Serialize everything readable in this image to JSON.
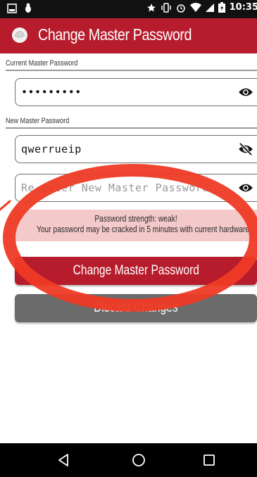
{
  "status_bar": {
    "time": "10:35"
  },
  "app_bar": {
    "title": "Change Master Password",
    "icon": "fingerprint-icon"
  },
  "current_section": {
    "label": "Current Master Password",
    "value": "•••••••••",
    "visibility_icon": "eye-icon"
  },
  "new_section": {
    "label": "New Master Password",
    "value": "qwerrueip",
    "visibility_icon": "eye-off-icon",
    "reenter_placeholder": "Re-enter New Master Password",
    "reenter_visibility_icon": "eye-icon"
  },
  "strength": {
    "line1": "Password strength: weak!",
    "line2": "Your password may be cracked in 5 minutes with current hardware."
  },
  "buttons": {
    "change_label": "Change Master Password",
    "discard_label": "Discard Changes"
  },
  "colors": {
    "accent": "#b71c2c",
    "annotation": "#ee3a24",
    "strength_bg": "#f3c9c9",
    "discard_bg": "#6b6b6b"
  }
}
